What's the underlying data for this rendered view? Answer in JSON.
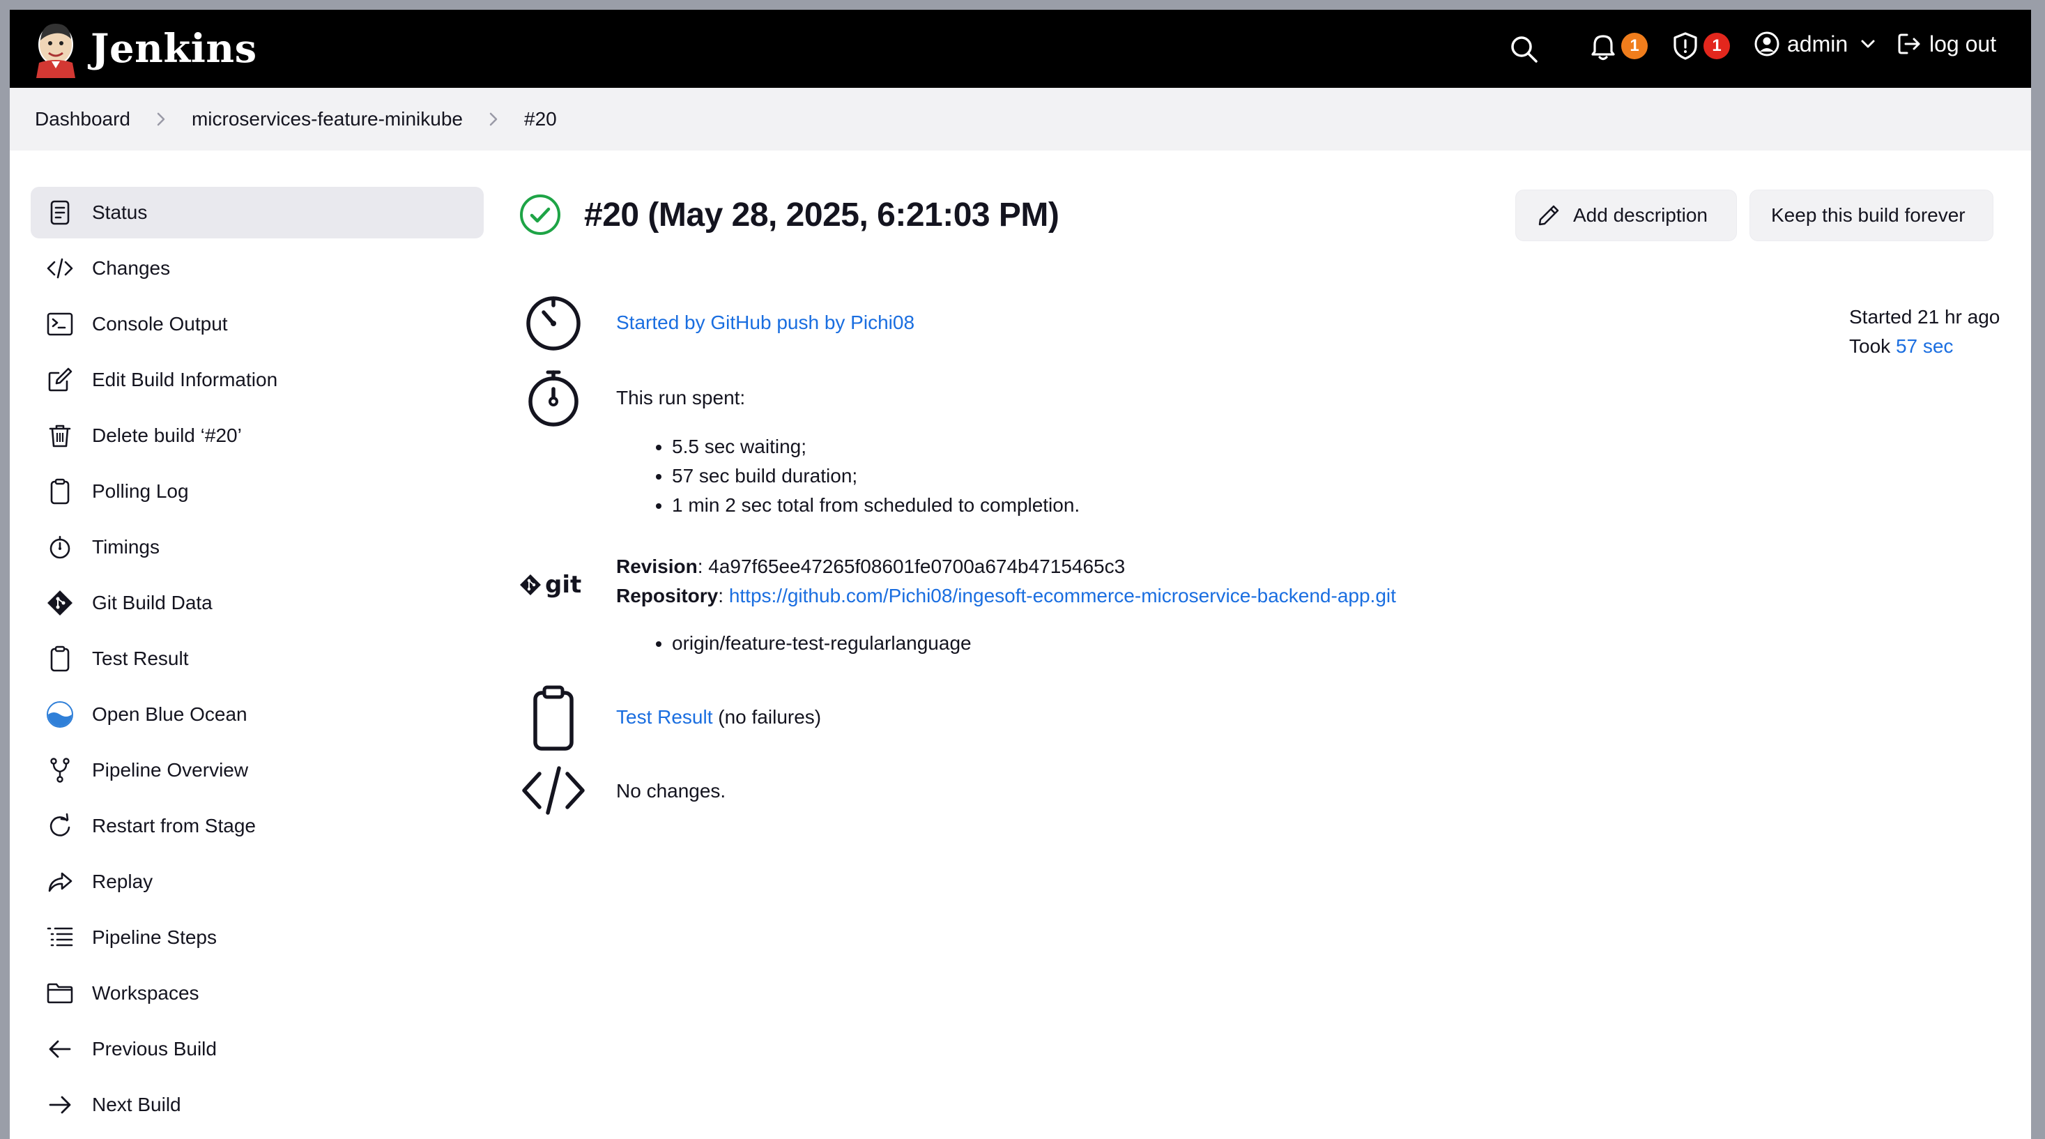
{
  "header": {
    "app_name": "Jenkins",
    "notifications_count": "1",
    "security_count": "1",
    "user_name": "admin",
    "logout_label": "log out"
  },
  "breadcrumb": [
    "Dashboard",
    "microservices-feature-minikube",
    "#20"
  ],
  "sidebar": {
    "items": [
      {
        "label": "Status",
        "icon": "status-icon"
      },
      {
        "label": "Changes",
        "icon": "code-icon"
      },
      {
        "label": "Console Output",
        "icon": "terminal-icon"
      },
      {
        "label": "Edit Build Information",
        "icon": "edit-icon"
      },
      {
        "label": "Delete build ‘#20’",
        "icon": "trash-icon"
      },
      {
        "label": "Polling Log",
        "icon": "clipboard-icon"
      },
      {
        "label": "Timings",
        "icon": "stopwatch-icon"
      },
      {
        "label": "Git Build Data",
        "icon": "git-icon"
      },
      {
        "label": "Test Result",
        "icon": "clipboard-icon"
      },
      {
        "label": "Open Blue Ocean",
        "icon": "blue-ocean-icon"
      },
      {
        "label": "Pipeline Overview",
        "icon": "branch-icon"
      },
      {
        "label": "Restart from Stage",
        "icon": "restart-icon"
      },
      {
        "label": "Replay",
        "icon": "replay-icon"
      },
      {
        "label": "Pipeline Steps",
        "icon": "list-icon"
      },
      {
        "label": "Workspaces",
        "icon": "folder-icon"
      },
      {
        "label": "Previous Build",
        "icon": "arrow-left-icon"
      },
      {
        "label": "Next Build",
        "icon": "arrow-right-icon"
      }
    ]
  },
  "build": {
    "title": "#20 (May 28, 2025, 6:21:03 PM)",
    "add_description_label": "Add description",
    "keep_forever_label": "Keep this build forever",
    "started_by": "Started by GitHub push by Pichi08",
    "started_ago": "Started 21 hr ago",
    "took_prefix": "Took ",
    "took_value": "57 sec",
    "run_spent_label": "This run spent:",
    "run_spent": [
      "5.5 sec waiting;",
      "57 sec build duration;",
      "1 min 2 sec total from scheduled to completion."
    ],
    "revision_label": "Revision",
    "revision_value": "4a97f65ee47265f08601fe0700a674b4715465c3",
    "repository_label": "Repository",
    "repository_url": "https://github.com/Pichi08/ingesoft-ecommerce-microservice-backend-app.git",
    "branches": [
      "origin/feature-test-regularlanguage"
    ],
    "test_result_link": "Test Result",
    "test_result_suffix": " (no failures)",
    "changes_text": "No changes."
  },
  "colors": {
    "topbar": "#000000",
    "link": "#1a6ee0",
    "success": "#1ea446",
    "badge_orange": "#f07d1c",
    "badge_red": "#e3271d",
    "sidebar_active": "#e9e9ee"
  }
}
